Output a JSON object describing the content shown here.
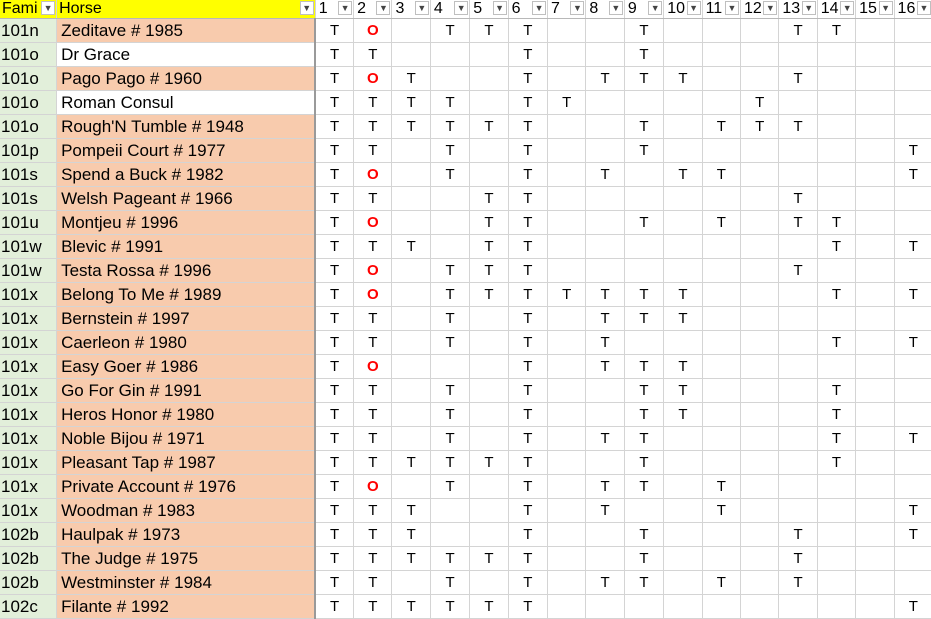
{
  "headers": {
    "family": "Fami",
    "horse": "Horse",
    "nums": [
      "1",
      "2",
      "3",
      "4",
      "5",
      "6",
      "7",
      "8",
      "9",
      "10",
      "11",
      "12",
      "13",
      "14",
      "15",
      "16"
    ]
  },
  "icons": {
    "filter_dropdown": "chevron-down-icon",
    "active_filter": "filter-icon"
  },
  "colors": {
    "header_bg": "#ffff00",
    "family_bg": "#e2efda",
    "horse_bg": "#f8cbad",
    "o_color": "#ff0000"
  },
  "rows": [
    {
      "family": "101n",
      "horse": "Zeditave #  1985",
      "fill": "peach",
      "cells": [
        "T",
        "O",
        "",
        "T",
        "T",
        "T",
        "",
        "",
        "T",
        "",
        "",
        "",
        "T",
        "T",
        "",
        ""
      ]
    },
    {
      "family": "101o",
      "horse": "Dr Grace",
      "fill": "white",
      "cells": [
        "T",
        "T",
        "",
        "",
        "",
        "T",
        "",
        "",
        "T",
        "",
        "",
        "",
        "",
        "",
        "",
        ""
      ]
    },
    {
      "family": "101o",
      "horse": "Pago Pago #  1960",
      "fill": "peach",
      "cells": [
        "T",
        "O",
        "T",
        "",
        "",
        "T",
        "",
        "T",
        "T",
        "T",
        "",
        "",
        "T",
        "",
        "",
        ""
      ]
    },
    {
      "family": "101o",
      "horse": "Roman Consul",
      "fill": "white",
      "cells": [
        "T",
        "T",
        "T",
        "T",
        "",
        "T",
        "T",
        "",
        "",
        "",
        "",
        "T",
        "",
        "",
        "",
        ""
      ]
    },
    {
      "family": "101o",
      "horse": "Rough'N Tumble #  1948",
      "fill": "peach",
      "cells": [
        "T",
        "T",
        "T",
        "T",
        "T",
        "T",
        "",
        "",
        "T",
        "",
        "T",
        "T",
        "T",
        "",
        "",
        ""
      ]
    },
    {
      "family": "101p",
      "horse": "Pompeii Court #  1977",
      "fill": "peach",
      "cells": [
        "T",
        "T",
        "",
        "T",
        "",
        "T",
        "",
        "",
        "T",
        "",
        "",
        "",
        "",
        "",
        "",
        "T"
      ]
    },
    {
      "family": "101s",
      "horse": "Spend a Buck #  1982",
      "fill": "peach",
      "cells": [
        "T",
        "O",
        "",
        "T",
        "",
        "T",
        "",
        "T",
        "",
        "T",
        "T",
        "",
        "",
        "",
        "",
        "T"
      ]
    },
    {
      "family": "101s",
      "horse": "Welsh Pageant #  1966",
      "fill": "peach",
      "cells": [
        "T",
        "T",
        "",
        "",
        "T",
        "T",
        "",
        "",
        "",
        "",
        "",
        "",
        "T",
        "",
        "",
        ""
      ]
    },
    {
      "family": "101u",
      "horse": "Montjeu #  1996",
      "fill": "peach",
      "cells": [
        "T",
        "O",
        "",
        "",
        "T",
        "T",
        "",
        "",
        "T",
        "",
        "T",
        "",
        "T",
        "T",
        "",
        ""
      ]
    },
    {
      "family": "101w",
      "horse": "Blevic #  1991",
      "fill": "peach",
      "cells": [
        "T",
        "T",
        "T",
        "",
        "T",
        "T",
        "",
        "",
        "",
        "",
        "",
        "",
        "",
        "T",
        "",
        "T"
      ]
    },
    {
      "family": "101w",
      "horse": "Testa Rossa #  1996",
      "fill": "peach",
      "cells": [
        "T",
        "O",
        "",
        "T",
        "T",
        "T",
        "",
        "",
        "",
        "",
        "",
        "",
        "T",
        "",
        "",
        ""
      ]
    },
    {
      "family": "101x",
      "horse": "Belong To Me #  1989",
      "fill": "peach",
      "cells": [
        "T",
        "O",
        "",
        "T",
        "T",
        "T",
        "T",
        "T",
        "T",
        "T",
        "",
        "",
        "",
        "T",
        "",
        "T"
      ]
    },
    {
      "family": "101x",
      "horse": "Bernstein #  1997",
      "fill": "peach",
      "cells": [
        "T",
        "T",
        "",
        "T",
        "",
        "T",
        "",
        "T",
        "T",
        "T",
        "",
        "",
        "",
        "",
        "",
        ""
      ]
    },
    {
      "family": "101x",
      "horse": "Caerleon #  1980",
      "fill": "peach",
      "cells": [
        "T",
        "T",
        "",
        "T",
        "",
        "T",
        "",
        "T",
        "",
        "",
        "",
        "",
        "",
        "T",
        "",
        "T"
      ]
    },
    {
      "family": "101x",
      "horse": "Easy Goer #  1986",
      "fill": "peach",
      "cells": [
        "T",
        "O",
        "",
        "",
        "",
        "T",
        "",
        "T",
        "T",
        "T",
        "",
        "",
        "",
        "",
        "",
        ""
      ]
    },
    {
      "family": "101x",
      "horse": "Go For Gin #  1991",
      "fill": "peach",
      "cells": [
        "T",
        "T",
        "",
        "T",
        "",
        "T",
        "",
        "",
        "T",
        "T",
        "",
        "",
        "",
        "T",
        "",
        ""
      ]
    },
    {
      "family": "101x",
      "horse": "Heros Honor #  1980",
      "fill": "peach",
      "cells": [
        "T",
        "T",
        "",
        "T",
        "",
        "T",
        "",
        "",
        "T",
        "T",
        "",
        "",
        "",
        "T",
        "",
        ""
      ]
    },
    {
      "family": "101x",
      "horse": "Noble Bijou #  1971",
      "fill": "peach",
      "cells": [
        "T",
        "T",
        "",
        "T",
        "",
        "T",
        "",
        "T",
        "T",
        "",
        "",
        "",
        "",
        "T",
        "",
        "T"
      ]
    },
    {
      "family": "101x",
      "horse": "Pleasant Tap #  1987",
      "fill": "peach",
      "cells": [
        "T",
        "T",
        "T",
        "T",
        "T",
        "T",
        "",
        "",
        "T",
        "",
        "",
        "",
        "",
        "T",
        "",
        ""
      ]
    },
    {
      "family": "101x",
      "horse": "Private Account #  1976",
      "fill": "peach",
      "cells": [
        "T",
        "O",
        "",
        "T",
        "",
        "T",
        "",
        "T",
        "T",
        "",
        "T",
        "",
        "",
        "",
        "",
        ""
      ]
    },
    {
      "family": "101x",
      "horse": "Woodman #  1983",
      "fill": "peach",
      "cells": [
        "T",
        "T",
        "T",
        "",
        "",
        "T",
        "",
        "T",
        "",
        "",
        "T",
        "",
        "",
        "",
        "",
        "T"
      ]
    },
    {
      "family": "102b",
      "horse": "Haulpak #  1973",
      "fill": "peach",
      "cells": [
        "T",
        "T",
        "T",
        "",
        "",
        "T",
        "",
        "",
        "T",
        "",
        "",
        "",
        "T",
        "",
        "",
        "T"
      ]
    },
    {
      "family": "102b",
      "horse": "The Judge #  1975",
      "fill": "peach",
      "cells": [
        "T",
        "T",
        "T",
        "T",
        "T",
        "T",
        "",
        "",
        "T",
        "",
        "",
        "",
        "T",
        "",
        "",
        ""
      ]
    },
    {
      "family": "102b",
      "horse": "Westminster #  1984",
      "fill": "peach",
      "cells": [
        "T",
        "T",
        "",
        "T",
        "",
        "T",
        "",
        "T",
        "T",
        "",
        "T",
        "",
        "T",
        "",
        "",
        ""
      ]
    },
    {
      "family": "102c",
      "horse": "Filante #  1992",
      "fill": "peach",
      "cells": [
        "T",
        "T",
        "T",
        "T",
        "T",
        "T",
        "",
        "",
        "",
        "",
        "",
        "",
        "",
        "",
        "",
        "T"
      ]
    }
  ]
}
